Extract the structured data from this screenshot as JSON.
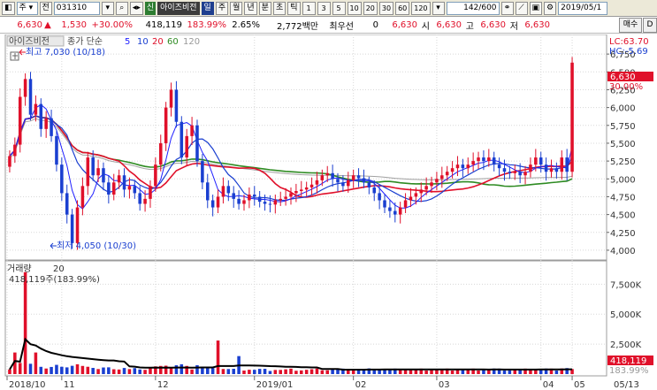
{
  "toolbar": {
    "market_select": "주",
    "search_label": "전",
    "code": "031310",
    "name": "아이즈비전",
    "badge": "신",
    "periods": [
      "일",
      "주",
      "월",
      "년",
      "분",
      "초",
      "틱"
    ],
    "selected_period": "일",
    "minutes": [
      "1",
      "3",
      "5",
      "10",
      "20",
      "30",
      "60",
      "120"
    ],
    "count": "142",
    "total": "600",
    "date": "2019/05/1",
    "buy_label": "매수"
  },
  "quote": {
    "price": "6,630",
    "arrow": "▲",
    "change": "1,530",
    "rate": "+30.00%",
    "volume": "418,119",
    "volume_rate": "183.99%",
    "turnover": "2.65%",
    "amount": "2,772백만",
    "preferred_label": "최우선",
    "preferred_value": "0",
    "ask": "6,630",
    "open_label": "시",
    "open": "6,630",
    "high_label": "고",
    "high": "6,630",
    "low_label": "저",
    "low": "6,630"
  },
  "price_panel": {
    "legend_name": "아이즈비전",
    "legend_type": "종가 단순",
    "ma_periods": [
      "5",
      "10",
      "20",
      "60",
      "120"
    ],
    "lc": "LC:63.70",
    "hc": "HC:-5.69",
    "max_label": "최고 7,030 (10/18)",
    "min_label": "최저 4,050 (10/30)",
    "last_price": "6,630",
    "last_rate": "30.00%"
  },
  "volume_panel": {
    "title": "거래량",
    "period": "20",
    "current": "418,119주(183.99%)",
    "last_volume": "418,119",
    "last_rate": "183.99%"
  },
  "colors": {
    "up": "#e0102a",
    "down": "#1a3fd0",
    "ma5": "#2020ff",
    "ma10": "#1a3fd0",
    "ma20": "#e0102a",
    "ma60": "#2e8b22",
    "ma120": "#a0a0a0"
  },
  "chart_data": {
    "type": "candlestick",
    "y_axis": {
      "ticks": [
        "6,750",
        "6,500",
        "6,250",
        "6,000",
        "5,750",
        "5,500",
        "5,250",
        "5,000",
        "4,750",
        "4,500",
        "4,250",
        "4,000"
      ],
      "range": [
        3900,
        6950
      ]
    },
    "volume_axis": {
      "ticks": [
        "7,500K",
        "5,000K",
        "2,500K"
      ],
      "range": [
        0,
        9000000
      ]
    },
    "x_axis": {
      "ticks": [
        "2018/10",
        "11",
        "12",
        "2019/01",
        "02",
        "03",
        "04",
        "05"
      ],
      "last_date": "05/13"
    },
    "series_close": [
      5320,
      5480,
      6150,
      6400,
      5900,
      6050,
      5700,
      5850,
      5600,
      5200,
      4800,
      4500,
      4100,
      4600,
      4900,
      5300,
      5050,
      5150,
      4950,
      4780,
      4950,
      5050,
      4850,
      4900,
      4800,
      4650,
      4720,
      4900,
      5200,
      5500,
      6000,
      6250,
      5800,
      5300,
      5600,
      5750,
      5250,
      4950,
      4700,
      4600,
      4750,
      4900,
      4800,
      4720,
      4650,
      4700,
      4780,
      4750,
      4680,
      4650,
      4640,
      4700,
      4720,
      4750,
      4800,
      4830,
      4850,
      4880,
      4920,
      4980,
      5050,
      5080,
      5000,
      4950,
      4900,
      4980,
      5050,
      5010,
      4950,
      4880,
      4800,
      4700,
      4600,
      4550,
      4500,
      4600,
      4700,
      4750,
      4800,
      4850,
      4900,
      4950,
      5000,
      5050,
      5100,
      5150,
      5200,
      5150,
      5200,
      5250,
      5300,
      5250,
      5300,
      5200,
      5150,
      5100,
      5080,
      5100,
      5050,
      5100,
      5200,
      5300,
      5200,
      5100,
      5150,
      5100,
      5300,
      5100,
      6630
    ]
  }
}
